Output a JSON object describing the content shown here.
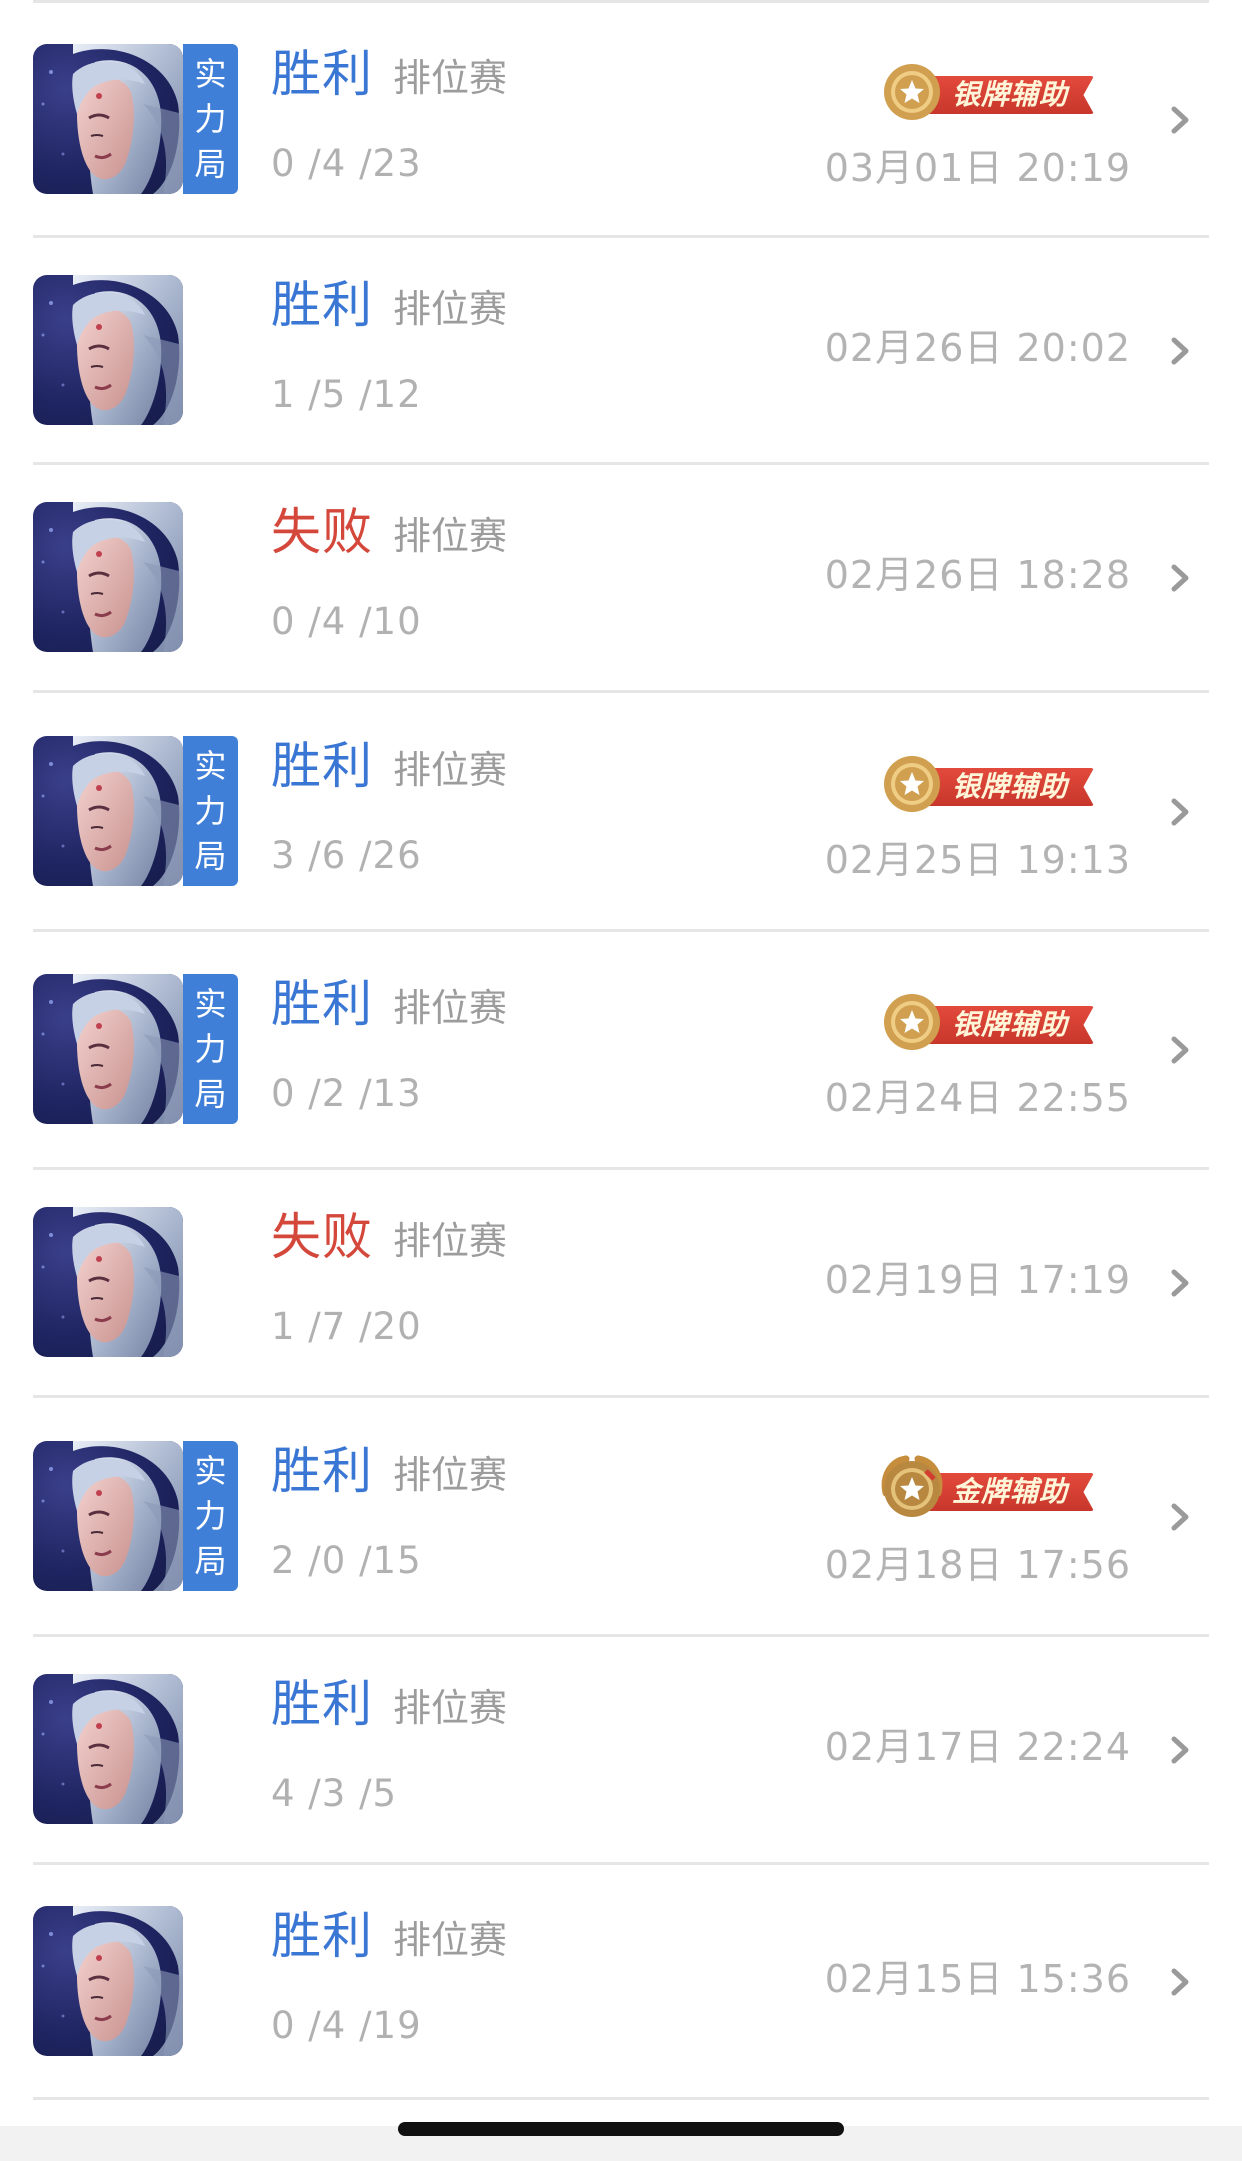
{
  "matches": [
    {
      "result": "胜利",
      "result_type": "win",
      "mode": "排位赛",
      "kda": "0 /4 /23",
      "time": "03月01日 20:19",
      "tag": [
        "实",
        "力",
        "局"
      ],
      "badge": "银牌辅助",
      "badge_type": "silver"
    },
    {
      "result": "胜利",
      "result_type": "win",
      "mode": "排位赛",
      "kda": "1 /5 /12",
      "time": "02月26日 20:02",
      "tag": null,
      "badge": null,
      "badge_type": null
    },
    {
      "result": "失败",
      "result_type": "loss",
      "mode": "排位赛",
      "kda": "0 /4 /10",
      "time": "02月26日 18:28",
      "tag": null,
      "badge": null,
      "badge_type": null
    },
    {
      "result": "胜利",
      "result_type": "win",
      "mode": "排位赛",
      "kda": "3 /6 /26",
      "time": "02月25日 19:13",
      "tag": [
        "实",
        "力",
        "局"
      ],
      "badge": "银牌辅助",
      "badge_type": "silver"
    },
    {
      "result": "胜利",
      "result_type": "win",
      "mode": "排位赛",
      "kda": "0 /2 /13",
      "time": "02月24日 22:55",
      "tag": [
        "实",
        "力",
        "局"
      ],
      "badge": "银牌辅助",
      "badge_type": "silver"
    },
    {
      "result": "失败",
      "result_type": "loss",
      "mode": "排位赛",
      "kda": "1 /7 /20",
      "time": "02月19日 17:19",
      "tag": null,
      "badge": null,
      "badge_type": null
    },
    {
      "result": "胜利",
      "result_type": "win",
      "mode": "排位赛",
      "kda": "2 /0 /15",
      "time": "02月18日 17:56",
      "tag": [
        "实",
        "力",
        "局"
      ],
      "badge": "金牌辅助",
      "badge_type": "gold"
    },
    {
      "result": "胜利",
      "result_type": "win",
      "mode": "排位赛",
      "kda": "4 /3 /5",
      "time": "02月17日 22:24",
      "tag": null,
      "badge": null,
      "badge_type": null
    },
    {
      "result": "胜利",
      "result_type": "win",
      "mode": "排位赛",
      "kda": "0 /4 /19",
      "time": "02月15日 15:36",
      "tag": null,
      "badge": null,
      "badge_type": null
    }
  ],
  "colors": {
    "win": "#3a76d3",
    "loss": "#d4473b",
    "tag_bg": "#3f7fd8",
    "badge_ribbon": "#d23d30",
    "medal_gold": "#c9984a"
  },
  "icons": {
    "chevron": "chevron-right-icon",
    "medal": "medal-icon",
    "avatar": "hero-avatar"
  }
}
